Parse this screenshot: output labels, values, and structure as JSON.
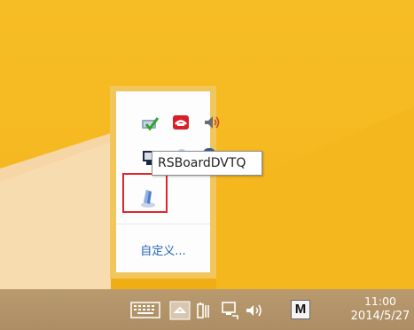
{
  "tray_popup": {
    "customize_label": "自定义..."
  },
  "tooltip": {
    "text": "RSBoardDVTQ"
  },
  "taskbar": {
    "ime_label": "M",
    "clock": {
      "time": "11:00",
      "date": "2014/5/27"
    }
  },
  "colors": {
    "desktop": "#f5b820",
    "taskbar": "#b2946b",
    "popup_border": "#f0c65d",
    "highlight": "#e0262a",
    "link": "#1e64b4"
  }
}
